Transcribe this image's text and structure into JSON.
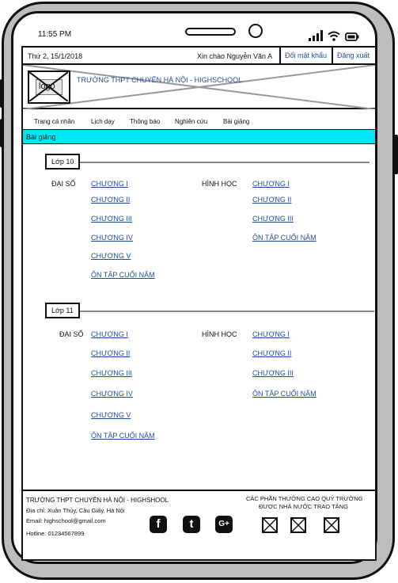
{
  "status_bar": {
    "time": "11:55 PM"
  },
  "topbar": {
    "date": "Thứ 2, 15/1/2018",
    "greeting": "Xin chào Nguyễn Văn A",
    "change_password": "Đổi mật khẩu",
    "logout": "Đăng xuất"
  },
  "header": {
    "logo_text": "logo",
    "school_name": "TRƯỜNG THPT CHUYÊN HÀ NỘI - HIGHSCHOOL"
  },
  "nav": {
    "items": [
      "Trang cá nhân",
      "Lịch dạy",
      "Thông báo",
      "Nghiên cứu",
      "Bài giảng"
    ]
  },
  "section": {
    "title": "Bài giảng"
  },
  "classes": [
    {
      "label": "Lớp 10",
      "subjects": [
        {
          "name": "ĐẠI SỐ",
          "chapters": [
            "CHƯƠNG I",
            "CHƯƠNG II",
            "CHƯƠNG III",
            "CHƯƠNG IV",
            "CHƯƠNG V",
            "ÔN TẬP CUỐI NĂM"
          ]
        },
        {
          "name": "HÌNH HỌC",
          "chapters": [
            "CHƯƠNG I",
            "CHƯƠNG II",
            "CHƯƠNG III",
            "ÔN TẬP CUỐI NĂM"
          ]
        }
      ]
    },
    {
      "label": "Lớp 11",
      "subjects": [
        {
          "name": "ĐẠI SỐ",
          "chapters": [
            "CHƯƠNG I",
            "CHƯƠNG II",
            "CHƯƠNG III",
            "CHƯƠNG IV",
            "CHƯƠNG V",
            "ÔN TẬP CUỐI NĂM"
          ]
        },
        {
          "name": "HÌNH HỌC",
          "chapters": [
            "CHƯƠNG I",
            "CHƯƠNG II",
            "CHƯƠNG III",
            "ÔN TẬP CUỐI NĂM"
          ]
        }
      ]
    }
  ],
  "footer": {
    "school_name": "TRƯỜNG THPT CHUYÊN HÀ NỘI - HIGHSHOOL",
    "address": "Địa chỉ: Xuân Thủy, Cầu Giấy, Hà Nội",
    "email": "Email: highschool@gmail.com",
    "hotline": "Hotline: 01234567899",
    "awards_line1": "CÁC PHẦN THƯỞNG CAO QUÝ TRƯỜNG",
    "awards_line2": "ĐƯỢC NHÀ NƯỚC TRAO TẶNG",
    "social": [
      "facebook-icon",
      "tumblr-icon",
      "google-plus-icon"
    ],
    "social_glyphs": [
      "f",
      "t",
      "G+"
    ]
  },
  "colors": {
    "accent": "#00e6f5",
    "link": "#1f4e9c",
    "frame": "#bdbdbd"
  }
}
